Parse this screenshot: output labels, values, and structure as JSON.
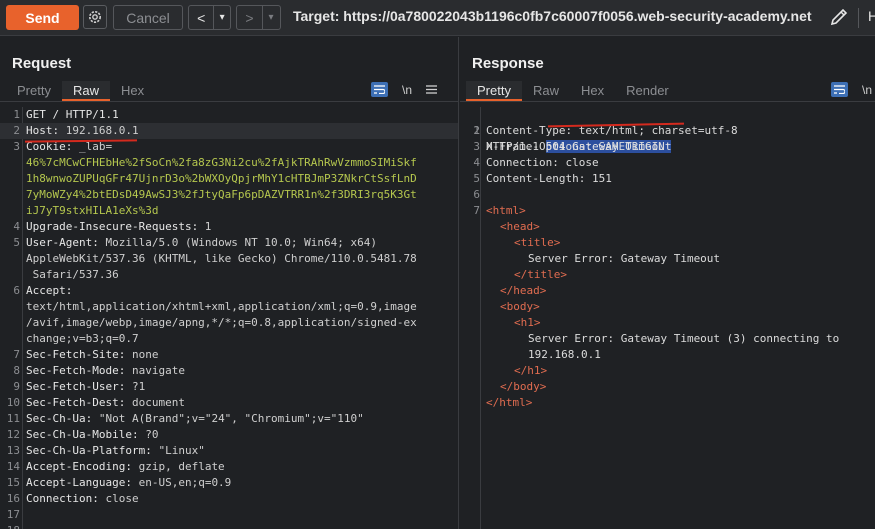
{
  "toolbar": {
    "send_label": "Send",
    "cancel_label": "Cancel",
    "back_label": "<",
    "back_dropdown": "▾",
    "forward_label": ">",
    "forward_dropdown": "▾",
    "target": "Target: https://0a780022043b1196c0fb7c60007f0056.web-security-academy.net",
    "extra_label": "H"
  },
  "request": {
    "title": "Request",
    "tabs": [
      "Pretty",
      "Raw",
      "Hex"
    ],
    "active_tab": "Raw",
    "newline_label": "\\n",
    "lines": [
      {
        "n": "1",
        "name": "GET / HTTP/1.1",
        "value": ""
      },
      {
        "n": "2",
        "name": "Host:",
        "value": " 192.168.0.1"
      },
      {
        "n": "3",
        "name": "Cookie:",
        "value": " _lab="
      },
      {
        "n": "",
        "name": "",
        "value": "46%7cMCwCFHEbHe%2fSoCn%2fa8zG3Ni2cu%2fAjkTRAhRwVzmmoSIMiSkf"
      },
      {
        "n": "",
        "name": "",
        "value": "1h8wnwoZUPUqGFr47UjnrD3o%2bWXOyQpjrMhY1cHTBJmP3ZNkrCtSsfLnD"
      },
      {
        "n": "",
        "name": "",
        "value": "7yMoWZy4%2btEDsD49AwSJ3%2fJtyQaFp6pDAZVTRR1n%2f3DRI3rq5K3Gt"
      },
      {
        "n": "",
        "name": "",
        "value": "iJ7yT9stxHILA1eXs%3d"
      },
      {
        "n": "4",
        "name": "Upgrade-Insecure-Requests:",
        "value": " 1"
      },
      {
        "n": "5",
        "name": "User-Agent:",
        "value": " Mozilla/5.0 (Windows NT 10.0; Win64; x64)"
      },
      {
        "n": "",
        "name": "",
        "value": "AppleWebKit/537.36 (KHTML, like Gecko) Chrome/110.0.5481.78"
      },
      {
        "n": "",
        "name": "",
        "value": " Safari/537.36"
      },
      {
        "n": "6",
        "name": "Accept:",
        "value": ""
      },
      {
        "n": "",
        "name": "",
        "value": "text/html,application/xhtml+xml,application/xml;q=0.9,image"
      },
      {
        "n": "",
        "name": "",
        "value": "/avif,image/webp,image/apng,*/*;q=0.8,application/signed-ex"
      },
      {
        "n": "",
        "name": "",
        "value": "change;v=b3;q=0.7"
      },
      {
        "n": "7",
        "name": "Sec-Fetch-Site:",
        "value": " none"
      },
      {
        "n": "8",
        "name": "Sec-Fetch-Mode:",
        "value": " navigate"
      },
      {
        "n": "9",
        "name": "Sec-Fetch-User:",
        "value": " ?1"
      },
      {
        "n": "10",
        "name": "Sec-Fetch-Dest:",
        "value": " document"
      },
      {
        "n": "11",
        "name": "Sec-Ch-Ua:",
        "value": " \"Not A(Brand\";v=\"24\", \"Chromium\";v=\"110\""
      },
      {
        "n": "12",
        "name": "Sec-Ch-Ua-Mobile:",
        "value": " ?0"
      },
      {
        "n": "13",
        "name": "Sec-Ch-Ua-Platform:",
        "value": " \"Linux\""
      },
      {
        "n": "14",
        "name": "Accept-Encoding:",
        "value": " gzip, deflate"
      },
      {
        "n": "15",
        "name": "Accept-Language:",
        "value": " en-US,en;q=0.9"
      },
      {
        "n": "16",
        "name": "Connection:",
        "value": " close"
      },
      {
        "n": "17",
        "name": "",
        "value": ""
      },
      {
        "n": "18",
        "name": "",
        "value": ""
      }
    ]
  },
  "response": {
    "title": "Response",
    "tabs": [
      "Pretty",
      "Raw",
      "Hex",
      "Render"
    ],
    "active_tab": "Pretty",
    "newline_label": "\\n",
    "status_prefix": "HTTP/1.1 ",
    "status_text": "504 Gateway Timeout",
    "lines": [
      {
        "n": "2",
        "text": "Content-Type: text/html; charset=utf-8",
        "indent": 0,
        "kind": "hdr"
      },
      {
        "n": "3",
        "text": "X-Frame-Options: SAMEORIGIN",
        "indent": 0,
        "kind": "hdr"
      },
      {
        "n": "4",
        "text": "Connection: close",
        "indent": 0,
        "kind": "hdr"
      },
      {
        "n": "5",
        "text": "Content-Length: 151",
        "indent": 0,
        "kind": "hdr"
      },
      {
        "n": "6",
        "text": "",
        "indent": 0,
        "kind": "hdr"
      },
      {
        "n": "7",
        "text": "<html>",
        "indent": 0,
        "kind": "tag"
      },
      {
        "n": "",
        "text": "<head>",
        "indent": 1,
        "kind": "tag"
      },
      {
        "n": "",
        "text": "<title>",
        "indent": 2,
        "kind": "tag"
      },
      {
        "n": "",
        "text": "Server Error: Gateway Timeout",
        "indent": 3,
        "kind": "text"
      },
      {
        "n": "",
        "text": "</title>",
        "indent": 2,
        "kind": "tag"
      },
      {
        "n": "",
        "text": "</head>",
        "indent": 1,
        "kind": "tag"
      },
      {
        "n": "",
        "text": "<body>",
        "indent": 1,
        "kind": "tag"
      },
      {
        "n": "",
        "text": "<h1>",
        "indent": 2,
        "kind": "tag"
      },
      {
        "n": "",
        "text": "Server Error: Gateway Timeout (3) connecting to",
        "indent": 3,
        "kind": "text"
      },
      {
        "n": "",
        "text": "192.168.0.1",
        "indent": 3,
        "kind": "text"
      },
      {
        "n": "",
        "text": "</h1>",
        "indent": 2,
        "kind": "tag"
      },
      {
        "n": "",
        "text": "</body>",
        "indent": 1,
        "kind": "tag"
      },
      {
        "n": "",
        "text": "</html>",
        "indent": 0,
        "kind": "tag"
      }
    ]
  },
  "colors": {
    "accent": "#e8622c",
    "selection": "#2c4f9e",
    "annotation": "#d42a1e"
  }
}
